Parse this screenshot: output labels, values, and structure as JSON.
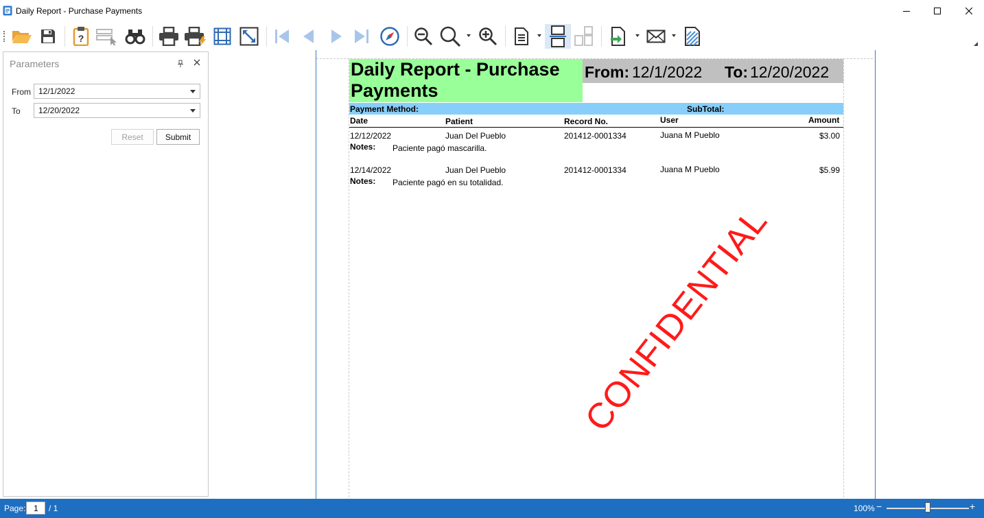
{
  "window": {
    "title": "Daily Report - Purchase Payments",
    "icons": [
      "app-icon",
      "minimize-icon",
      "maximize-icon",
      "close-icon"
    ]
  },
  "toolbar": {
    "buttons": [
      "open-folder-icon",
      "save-icon",
      "parameters-icon",
      "document-map-icon",
      "find-icon",
      "print-icon",
      "quick-print-icon",
      "page-setup-icon",
      "fit-page-icon",
      "first-page-icon",
      "previous-page-icon",
      "next-page-icon",
      "last-page-icon",
      "navigation-compass-icon",
      "zoom-out-icon",
      "zoom-icon",
      "zoom-in-icon",
      "single-page-icon",
      "continuous-page-icon",
      "multiple-pages-icon",
      "export-icon",
      "send-email-icon",
      "watermark-icon"
    ]
  },
  "parameters": {
    "title": "Parameters",
    "from_label": "From",
    "from_value": "12/1/2022",
    "to_label": "To",
    "to_value": "12/20/2022",
    "reset_label": "Reset",
    "submit_label": "Submit"
  },
  "report": {
    "title": "Daily Report - Purchase Payments",
    "from_label": "From:",
    "from_value": "12/1/2022",
    "to_label": "To:",
    "to_value": "12/20/2022",
    "payment_method_label": "Payment Method:",
    "subtotal_label": "SubTotal:",
    "columns": {
      "date": "Date",
      "patient": "Patient",
      "record_no": "Record No.",
      "user": "User",
      "amount": "Amount"
    },
    "notes_label": "Notes:",
    "rows": [
      {
        "date": "12/12/2022",
        "patient": "Juan Del Pueblo",
        "record_no": "201412-0001334",
        "user": "Juana M Pueblo",
        "amount": "$3.00",
        "notes": "Paciente pagó mascarilla."
      },
      {
        "date": "12/14/2022",
        "patient": "Juan Del Pueblo",
        "record_no": "201412-0001334",
        "user": "Juana M Pueblo",
        "amount": "$5.99",
        "notes": "Paciente pagó en su totalidad."
      }
    ],
    "watermark": "CONFIDENTIAL",
    "colors": {
      "title_bg": "#99ff99",
      "date_bg": "#c0c0c0",
      "method_bg": "#87cefa",
      "watermark": "#ff1a1a"
    }
  },
  "statusbar": {
    "page_label": "Page:",
    "page_value": "1",
    "page_total": "/ 1",
    "zoom": "100%",
    "zoom_fraction": 0.5,
    "color": "#1e6fc1"
  }
}
